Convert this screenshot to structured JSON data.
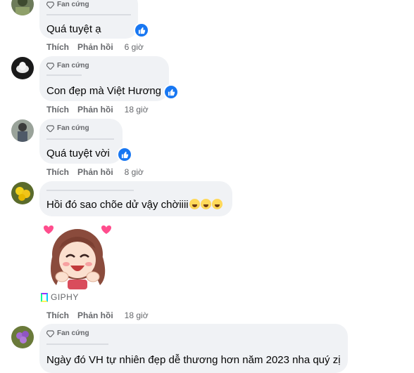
{
  "badge_label": "Fan cứng",
  "comments": [
    {
      "text": "Quá tuyệt ạ",
      "actions": {
        "like": "Thích",
        "reply": "Phản hồi",
        "time": "6 giờ"
      }
    },
    {
      "text": "Con đẹp mà Việt Hương",
      "actions": {
        "like": "Thích",
        "reply": "Phản hồi",
        "time": "18 giờ"
      }
    },
    {
      "text": "Quá tuyệt vời",
      "actions": {
        "like": "Thích",
        "reply": "Phản hồi",
        "time": "8 giờ"
      }
    },
    {
      "text": "Hồi đó sao chõe dử vậy chờiiii",
      "actions": {
        "like": "Thích",
        "reply": "Phản hồi",
        "time": "18 giờ"
      },
      "gif_source": "GIPHY"
    },
    {
      "text": "Ngày đó VH tự nhiên đẹp dễ thương hơn năm 2023 nha quý zị"
    }
  ],
  "colors": {
    "bubble": "#f0f2f5",
    "meta_text": "#65676b",
    "like_blue": "#1877f2"
  }
}
